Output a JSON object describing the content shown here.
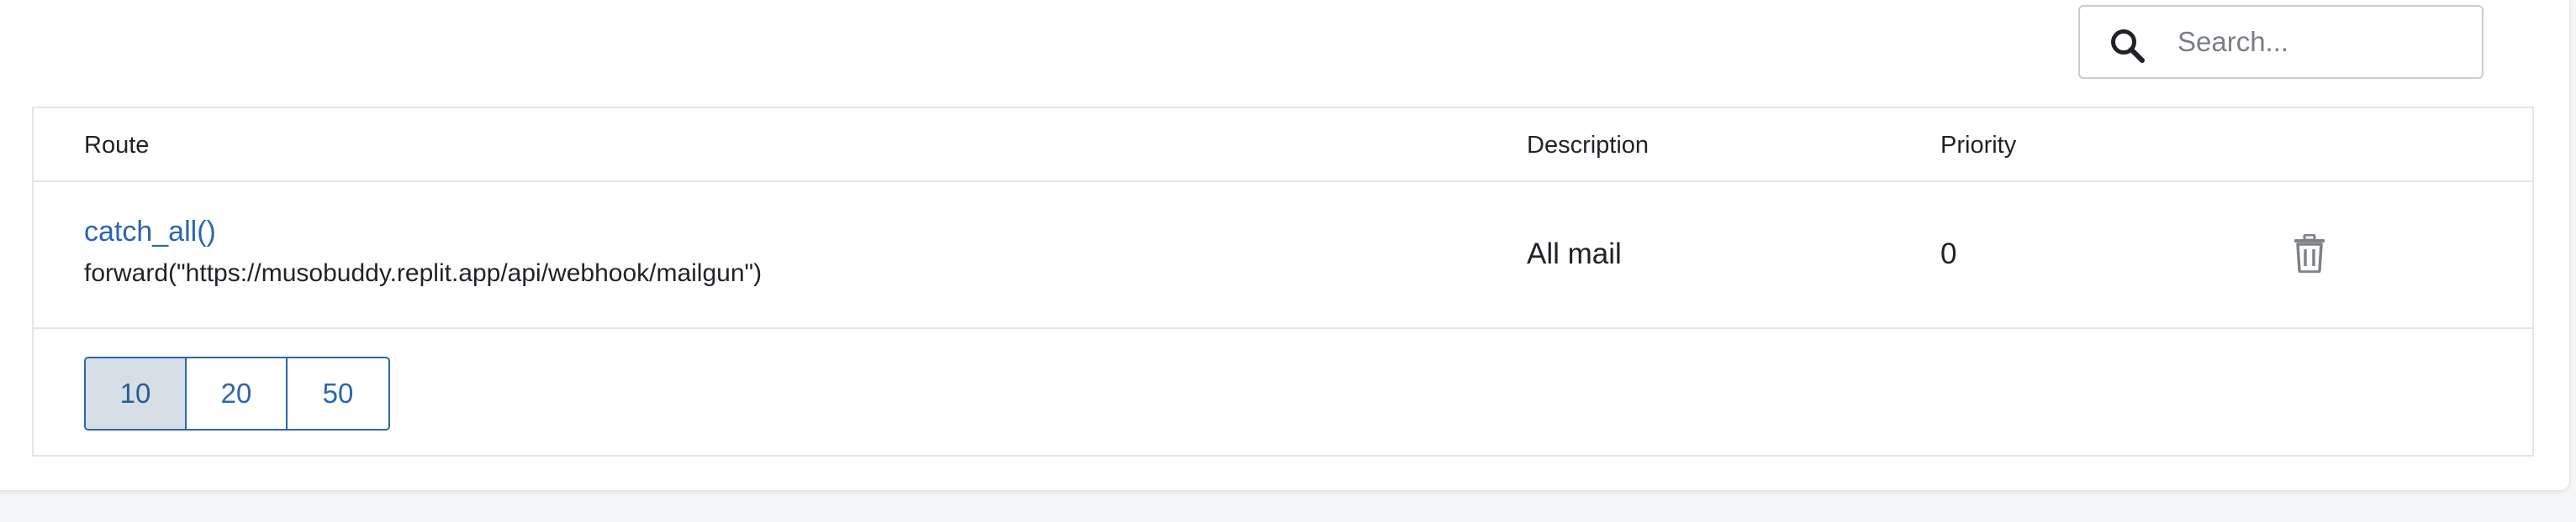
{
  "search": {
    "placeholder": "Search..."
  },
  "table": {
    "headers": {
      "route": "Route",
      "description": "Description",
      "priority": "Priority"
    },
    "rows": [
      {
        "route_name": "catch_all()",
        "route_action": "forward(\"https://musobuddy.replit.app/api/webhook/mailgun\")",
        "description": "All mail",
        "priority": "0"
      }
    ]
  },
  "pagination": {
    "page_sizes": [
      "10",
      "20",
      "50"
    ],
    "selected": "10"
  },
  "icons": {
    "search": "search-icon",
    "delete": "trash-icon"
  },
  "colors": {
    "link": "#2a66b0",
    "active_page_bg": "#d6dee6",
    "border": "#e2e5e9"
  }
}
